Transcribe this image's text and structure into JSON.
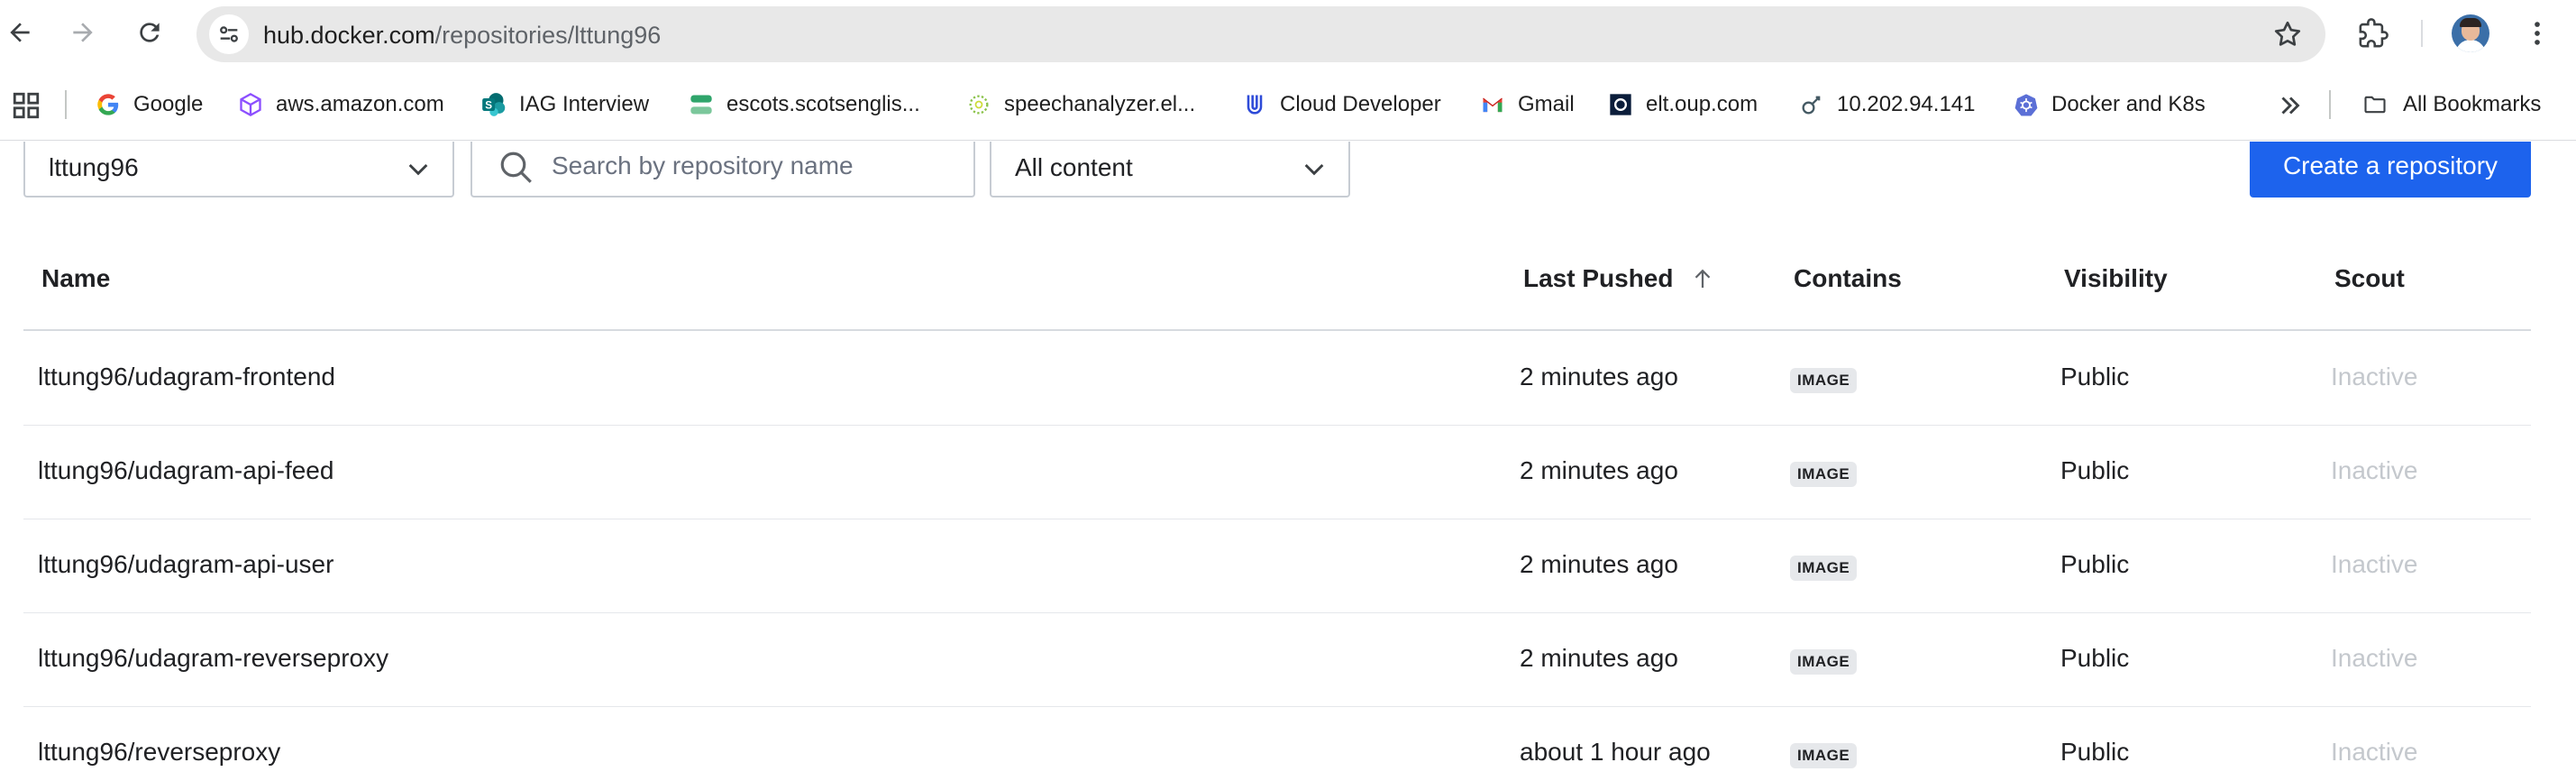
{
  "browser": {
    "url_host": "hub.docker.com",
    "url_path": "/repositories/lttung96",
    "icons": [
      "back-icon",
      "forward-icon",
      "reload-icon",
      "site-info-icon",
      "bookmark-star-icon",
      "extensions-icon",
      "profile-avatar",
      "menu-icon"
    ]
  },
  "bookmarks": {
    "items": [
      {
        "label": "Google",
        "icon": "google-icon"
      },
      {
        "label": "aws.amazon.com",
        "icon": "aws-icon"
      },
      {
        "label": "IAG Interview",
        "icon": "sharepoint-icon"
      },
      {
        "label": "escots.scotsenglis...",
        "icon": "escots-icon"
      },
      {
        "label": "speechanalyzer.el...",
        "icon": "speechanalyzer-icon"
      },
      {
        "label": "Cloud Developer",
        "icon": "udacity-icon"
      },
      {
        "label": "Gmail",
        "icon": "gmail-icon"
      },
      {
        "label": "elt.oup.com",
        "icon": "oup-icon"
      },
      {
        "label": "10.202.94.141",
        "icon": "server-icon"
      },
      {
        "label": "Docker and K8s",
        "icon": "kubernetes-icon"
      }
    ],
    "all_bookmarks_label": "All Bookmarks"
  },
  "filters": {
    "namespace": "lttung96",
    "search_placeholder": "Search by repository name",
    "search_value": "",
    "content_filter": "All content"
  },
  "actions": {
    "create_repository_label": "Create a repository"
  },
  "table": {
    "columns": {
      "name": "Name",
      "last_pushed": "Last Pushed",
      "contains": "Contains",
      "visibility": "Visibility",
      "scout": "Scout"
    },
    "sort": {
      "column": "last_pushed",
      "direction": "ascending"
    },
    "rows": [
      {
        "name": "lttung96/udagram-frontend",
        "last_pushed": "2 minutes ago",
        "contains": "IMAGE",
        "visibility": "Public",
        "scout": "Inactive"
      },
      {
        "name": "lttung96/udagram-api-feed",
        "last_pushed": "2 minutes ago",
        "contains": "IMAGE",
        "visibility": "Public",
        "scout": "Inactive"
      },
      {
        "name": "lttung96/udagram-api-user",
        "last_pushed": "2 minutes ago",
        "contains": "IMAGE",
        "visibility": "Public",
        "scout": "Inactive"
      },
      {
        "name": "lttung96/udagram-reverseproxy",
        "last_pushed": "2 minutes ago",
        "contains": "IMAGE",
        "visibility": "Public",
        "scout": "Inactive"
      },
      {
        "name": "lttung96/reverseproxy",
        "last_pushed": "about 1 hour ago",
        "contains": "IMAGE",
        "visibility": "Public",
        "scout": "Inactive"
      }
    ]
  },
  "colors": {
    "primary_button": "#1d63ed",
    "omnibox_bg": "#e8e8e8",
    "badge_bg": "#e6e8eb",
    "inactive_text": "#c4c8cd"
  }
}
